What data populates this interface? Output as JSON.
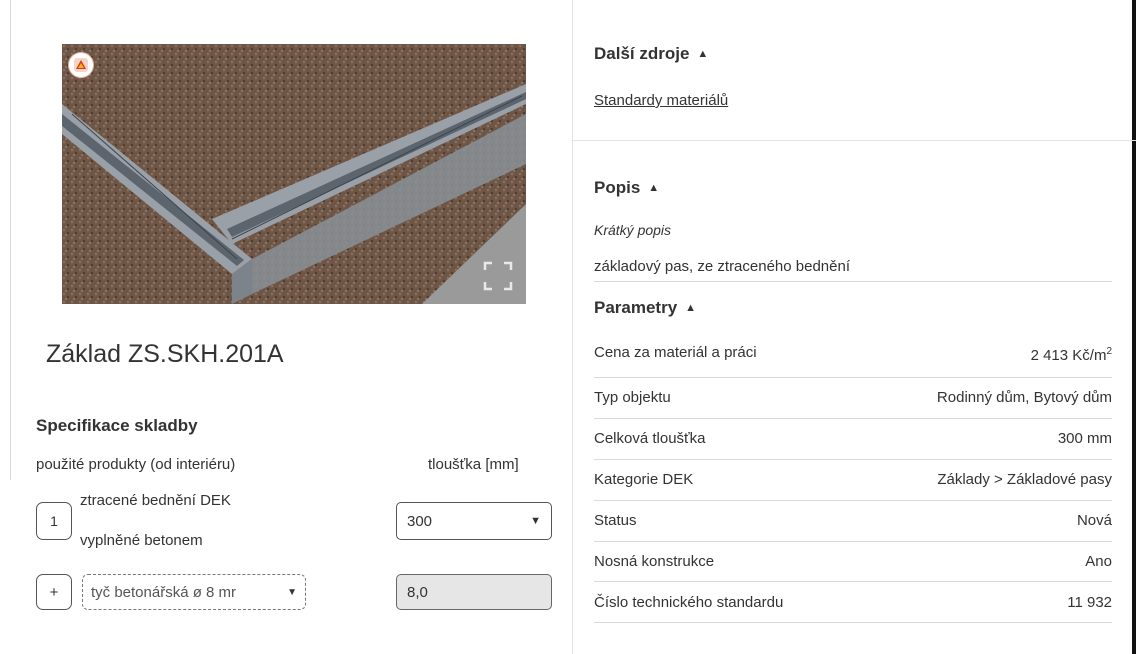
{
  "product": {
    "title": "Základ ZS.SKH.201A"
  },
  "spec": {
    "heading": "Specifikace skladby",
    "col_products": "použité produkty (od interiéru)",
    "col_thickness": "tloušťka [mm]",
    "layers": [
      {
        "index": "1",
        "name_line1": "ztracené bednění DEK",
        "name_line2": "vyplněné betonem",
        "thickness": "300"
      }
    ],
    "add_button": "+",
    "rebar_select": "tyč betonářská ø 8 mr",
    "rebar_value": "8,0"
  },
  "resources": {
    "heading": "Další zdroje",
    "link": "Standardy materiálů"
  },
  "description": {
    "heading": "Popis",
    "short_label": "Krátký popis",
    "text": "základový pas, ze ztraceného bednění"
  },
  "parameters": {
    "heading": "Parametry",
    "rows": [
      {
        "label": "Cena za materiál a práci",
        "value": "2 413 Kč/m",
        "sup": "2"
      },
      {
        "label": "Typ objektu",
        "value": "Rodinný dům, Bytový dům"
      },
      {
        "label": "Celková tloušťka",
        "value": "300 mm"
      },
      {
        "label": "Kategorie DEK",
        "value": "Základy > Základové pasy"
      },
      {
        "label": "Status",
        "value": "Nová"
      },
      {
        "label": "Nosná konstrukce",
        "value": "Ano"
      },
      {
        "label": "Číslo technického standardu",
        "value": "11 932"
      }
    ]
  },
  "colors": {
    "text": "#333333",
    "divider": "#d9d9d9",
    "readonly_bg": "#e6e6e6",
    "soil": "#6b5444",
    "formwork": "#8e949c"
  },
  "icons": {
    "logo": "dek-logo-icon",
    "fullscreen": "fullscreen-icon",
    "collapse": "triangle-up-icon",
    "dropdown": "caret-down-icon"
  }
}
